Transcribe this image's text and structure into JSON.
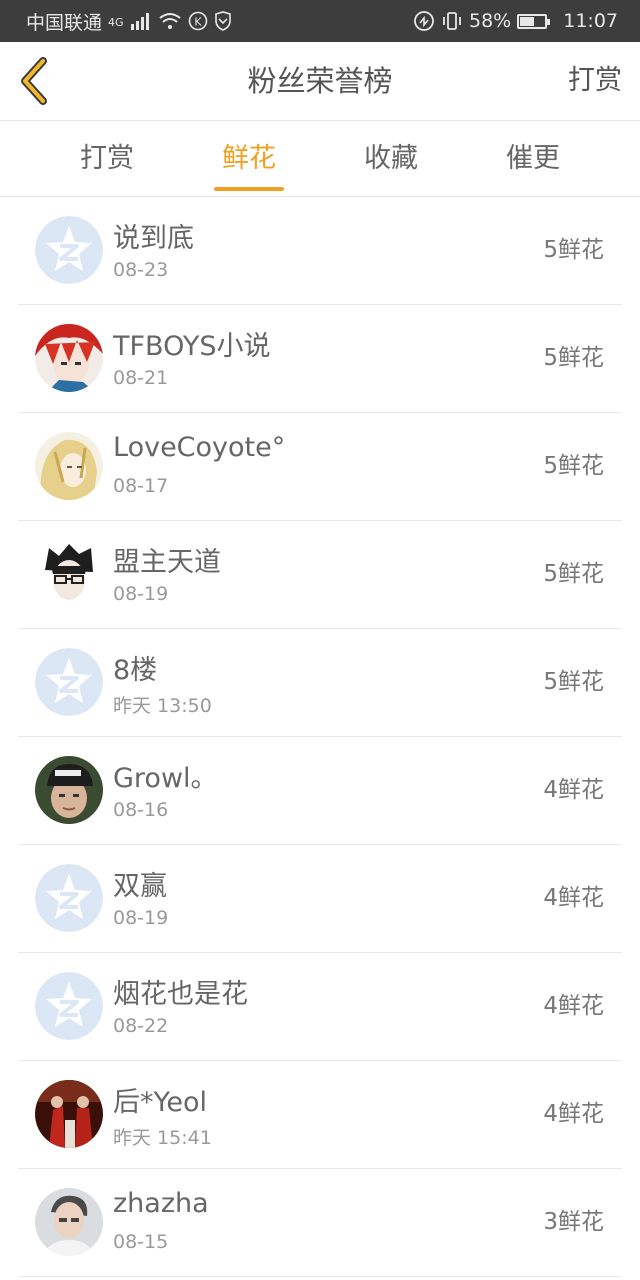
{
  "status": {
    "carrier": "中国联通",
    "network": "4G",
    "battery_percent": "58%",
    "battery_level": 0.58,
    "time": "11:07"
  },
  "header": {
    "title": "粉丝荣誉榜",
    "action_label": "打赏"
  },
  "tabs": [
    {
      "label": "打赏",
      "active": false
    },
    {
      "label": "鲜花",
      "active": true
    },
    {
      "label": "收藏",
      "active": false
    },
    {
      "label": "催更",
      "active": false
    }
  ],
  "colors": {
    "accent": "#f0a020",
    "default_avatar_bg": "#dbe7f5"
  },
  "rows": [
    {
      "name": "说到底",
      "date": "08-23",
      "flowers": "5鲜花",
      "avatar": "default-star"
    },
    {
      "name": "TFBOYS小说",
      "date": "08-21",
      "flowers": "5鲜花",
      "avatar": "anime-red-hair"
    },
    {
      "name": "LoveCoyote°",
      "date": "08-17",
      "flowers": "5鲜花",
      "avatar": "anime-blond"
    },
    {
      "name": "盟主天道",
      "date": "08-19",
      "flowers": "5鲜花",
      "avatar": "anime-glasses"
    },
    {
      "name": "8楼",
      "date": "昨天 13:50",
      "flowers": "5鲜花",
      "avatar": "default-star"
    },
    {
      "name": "Growl。",
      "date": "08-16",
      "flowers": "4鲜花",
      "avatar": "photo-cap"
    },
    {
      "name": "双赢",
      "date": "08-19",
      "flowers": "4鲜花",
      "avatar": "default-star"
    },
    {
      "name": "烟花也是花",
      "date": "08-22",
      "flowers": "4鲜花",
      "avatar": "default-star"
    },
    {
      "name": "后*Yeol",
      "date": "昨天 15:41",
      "flowers": "4鲜花",
      "avatar": "photo-red"
    },
    {
      "name": "zhazha",
      "date": "08-15",
      "flowers": "3鲜花",
      "avatar": "photo-person"
    }
  ]
}
